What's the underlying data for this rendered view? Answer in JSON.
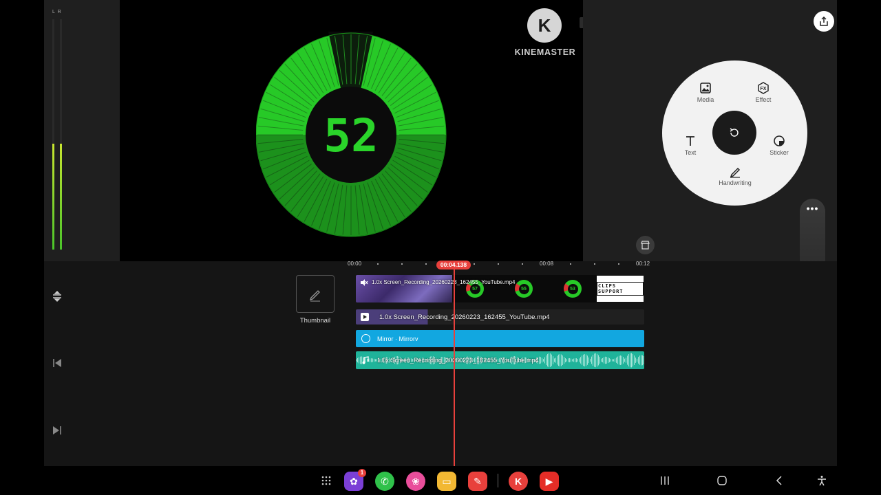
{
  "app_name": "KineMaster",
  "meter": {
    "channels_label": "L R",
    "left_level": 0.46,
    "right_level": 0.46
  },
  "preview": {
    "watermark": "KINEMASTER",
    "logo_letter": "K",
    "timer_value": "52",
    "crown_icon": "crown-icon"
  },
  "toolbar": {
    "export_icon": "share-icon",
    "store_icon": "asset-store-icon"
  },
  "media_wheel": {
    "media_label": "Media",
    "effect_label": "Effect",
    "text_label": "Text",
    "sticker_label": "Sticker",
    "handwriting_label": "Handwriting",
    "center_icon": "undo-icon"
  },
  "volume": {
    "menu_label": "•••",
    "level": 0.38
  },
  "ruler": {
    "labels": [
      "00:00",
      "00:08",
      "00:12"
    ],
    "playhead_time": "00:04.138"
  },
  "thumbnail": {
    "label": "Thumbnail"
  },
  "tracks": {
    "main_clip_label": "1.0x Screen_Recording_20260223_162455_YouTube.mp4",
    "main_clip_end_text": "CLIPS SUPPORT",
    "dial_values": [
      "57",
      "55",
      "53"
    ],
    "layer_clip_label": "1.0x Screen_Recording_20260223_162455_YouTube.mp4",
    "effect_label": "Mirror · Mirrorv",
    "audio_label": "1.0x Screen_Recording_20260223_162455_YouTube.mp4"
  },
  "dock": {
    "apps": [
      "apps-grid-icon",
      "galaxy-store-icon",
      "phone-icon",
      "blossom-icon",
      "files-icon",
      "notes-icon",
      "kinemaster-icon",
      "youtube-icon"
    ],
    "galaxy_store_badge": "1"
  },
  "nav": {
    "recents": "recents-icon",
    "home": "home-icon",
    "back": "back-icon",
    "accessibility": "accessibility-icon"
  },
  "colors": {
    "accent": "#e8403c",
    "timer_green": "#27c927",
    "effect_track": "#12a7e0",
    "audio_track": "#1fb39a"
  }
}
